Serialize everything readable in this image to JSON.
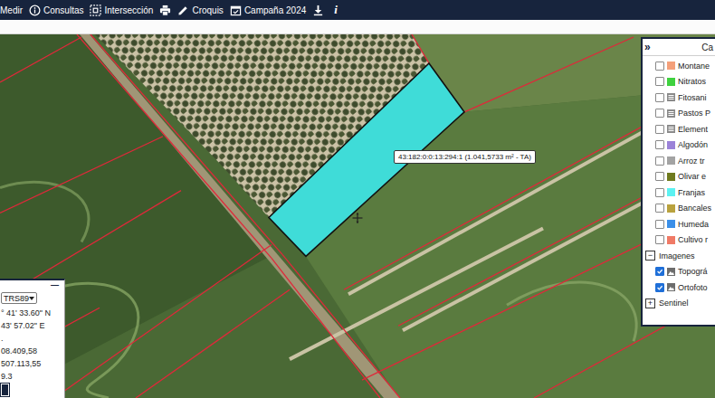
{
  "toolbar": {
    "items": [
      {
        "kind": "measure",
        "label": "Medir"
      },
      {
        "kind": "info",
        "label": "Consultas"
      },
      {
        "kind": "intersect",
        "label": "Intersección"
      },
      {
        "kind": "print"
      },
      {
        "kind": "sketch",
        "label": "Croquis"
      },
      {
        "kind": "calendar",
        "label": "Campaña 2024"
      },
      {
        "kind": "download"
      },
      {
        "kind": "about",
        "label": "i"
      }
    ]
  },
  "map": {
    "parcel": {
      "selected": true,
      "tooltip": "43:182:0:0:13:294:1 (1.041,5733 m² - TA)"
    }
  },
  "layers_panel": {
    "collapse": "»",
    "title": "Ca",
    "layers": [
      {
        "label": "Montane",
        "kind": "swatch",
        "color": "#f4a07a",
        "checked": false
      },
      {
        "label": "Nitratos",
        "kind": "swatch",
        "color": "#3fd13f",
        "checked": false
      },
      {
        "label": "Fitosani",
        "kind": "table",
        "checked": false
      },
      {
        "label": "Pastos P",
        "kind": "table",
        "checked": false
      },
      {
        "label": "Element",
        "kind": "table",
        "checked": false
      },
      {
        "label": "Algodón",
        "kind": "swatch",
        "color": "#9b82d8",
        "checked": false
      },
      {
        "label": "Arroz tr",
        "kind": "swatch",
        "color": "#a3a3a3",
        "checked": false
      },
      {
        "label": "Olivar e",
        "kind": "swatch",
        "color": "#6f7a1e",
        "checked": false
      },
      {
        "label": "Franjas",
        "kind": "swatch",
        "color": "#5cf2f2",
        "checked": false
      },
      {
        "label": "Bancales",
        "kind": "swatch",
        "color": "#b9a23e",
        "checked": false
      },
      {
        "label": "Humeda",
        "kind": "swatch",
        "color": "#3b8fe8",
        "checked": false
      },
      {
        "label": "Cultivo r",
        "kind": "swatch",
        "color": "#f07a66",
        "checked": false
      }
    ],
    "groups": [
      {
        "toggle": "−",
        "label": "Imagenes",
        "expanded": true,
        "items": [
          {
            "label": "Topográ",
            "checked": true
          },
          {
            "label": "Ortofoto",
            "checked": true
          }
        ]
      },
      {
        "toggle": "+",
        "label": "Sentinel",
        "expanded": false,
        "items": []
      }
    ]
  },
  "coords_panel": {
    "minimize": "—",
    "datum": "TRS89",
    "lines": [
      "° 41' 33.60\" N",
      "43' 57.02\" E",
      ".",
      "08.409,58",
      "507.113,55",
      "9.3"
    ]
  }
}
